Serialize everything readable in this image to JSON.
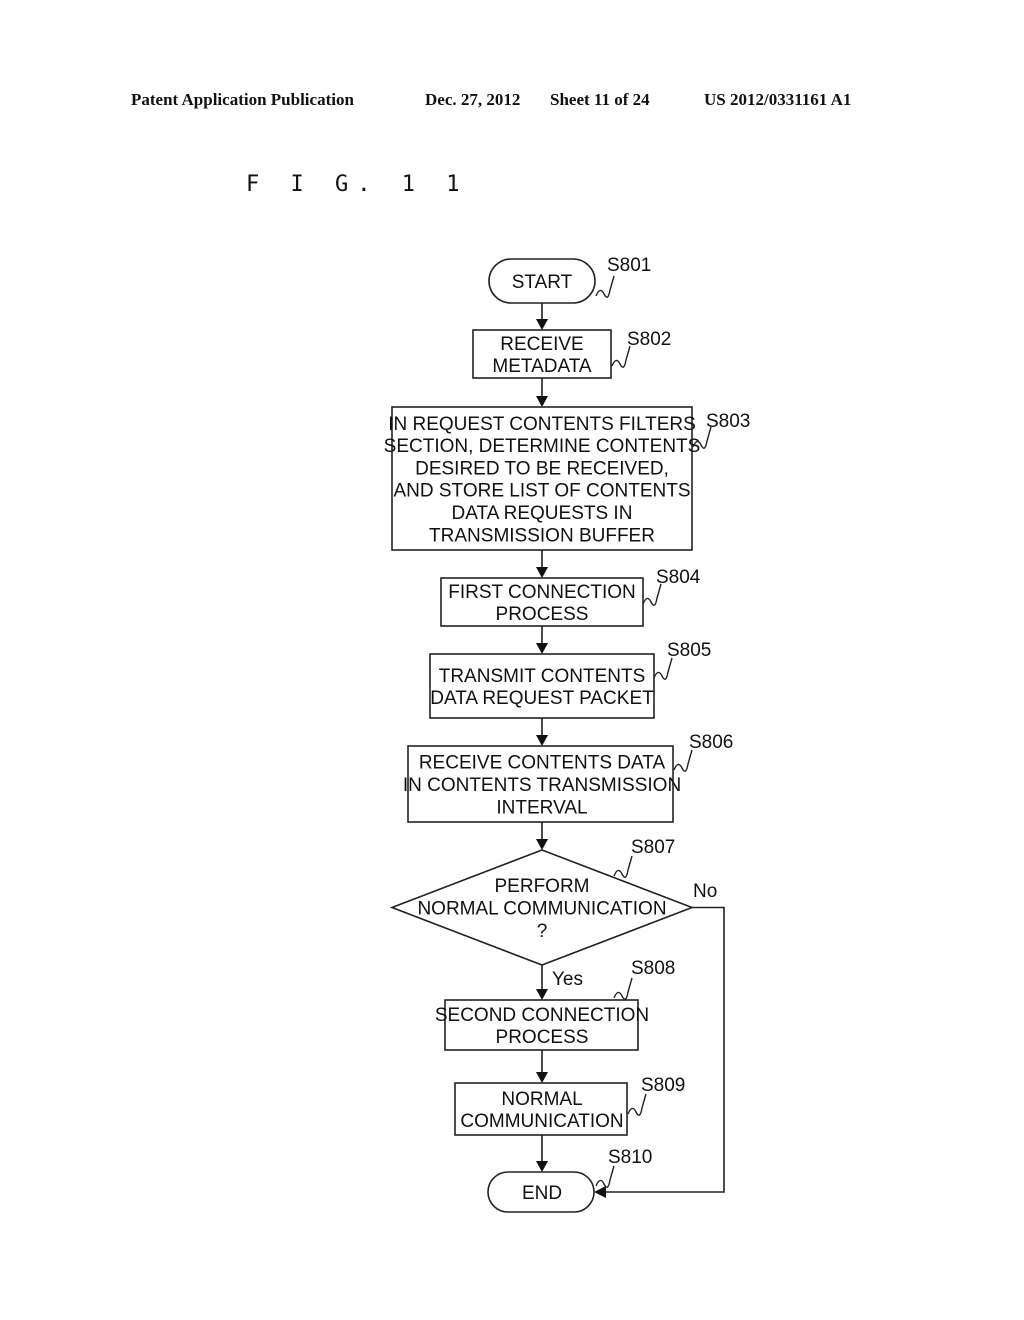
{
  "header": {
    "publication": "Patent Application Publication",
    "date": "Dec. 27, 2012",
    "sheet": "Sheet 11 of 24",
    "number": "US 2012/0331161 A1"
  },
  "figure_label": "F I G. 1 1",
  "steps": [
    {
      "id": "S801",
      "type": "terminal",
      "lines": [
        "START"
      ]
    },
    {
      "id": "S802",
      "type": "process",
      "lines": [
        "RECEIVE",
        "METADATA"
      ]
    },
    {
      "id": "S803",
      "type": "process",
      "lines": [
        "IN REQUEST CONTENTS FILTERS",
        "SECTION, DETERMINE CONTENTS",
        "DESIRED TO BE RECEIVED,",
        "AND STORE LIST OF CONTENTS",
        "DATA REQUESTS IN",
        "TRANSMISSION BUFFER"
      ]
    },
    {
      "id": "S804",
      "type": "process",
      "lines": [
        "FIRST CONNECTION",
        "PROCESS"
      ]
    },
    {
      "id": "S805",
      "type": "process",
      "lines": [
        "TRANSMIT CONTENTS",
        "DATA REQUEST PACKET"
      ]
    },
    {
      "id": "S806",
      "type": "process",
      "lines": [
        "RECEIVE CONTENTS DATA",
        "IN CONTENTS TRANSMISSION",
        "INTERVAL"
      ]
    },
    {
      "id": "S807",
      "type": "decision",
      "lines": [
        "PERFORM",
        "NORMAL COMMUNICATION",
        "?"
      ]
    },
    {
      "id": "S808",
      "type": "process",
      "lines": [
        "SECOND CONNECTION",
        "PROCESS"
      ]
    },
    {
      "id": "S809",
      "type": "process",
      "lines": [
        "NORMAL",
        "COMMUNICATION"
      ]
    },
    {
      "id": "S810",
      "type": "terminal",
      "lines": [
        "END"
      ]
    }
  ],
  "branches": {
    "yes": "Yes",
    "no": "No"
  }
}
